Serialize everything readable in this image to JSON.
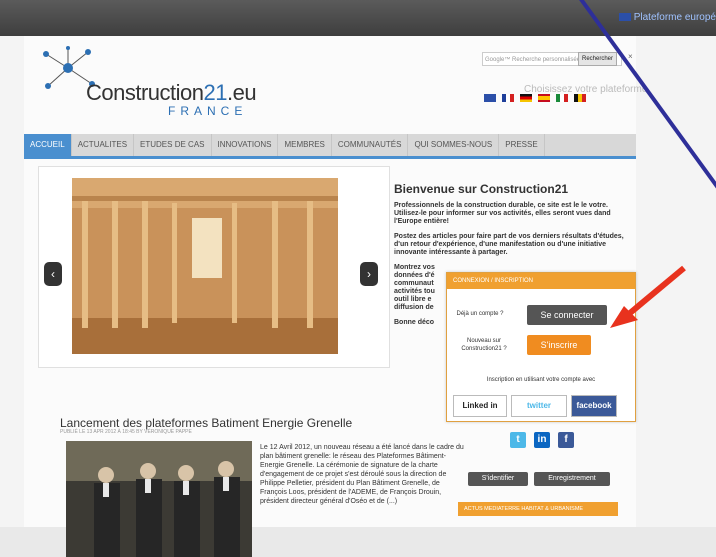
{
  "topbar": {
    "platform_label": "Plateforme europé"
  },
  "logo": {
    "name_prefix": "Construction",
    "name_number": "21",
    "name_suffix": ".eu",
    "country": "FRANCE"
  },
  "search": {
    "placeholder": "Google™ Recherche personnalisée",
    "button_label": "Rechercher",
    "clear": "×"
  },
  "language": {
    "title": "Choisissez votre plateforme"
  },
  "nav": {
    "tabs": [
      "ACCUEIL",
      "ACTUALITES",
      "ETUDES DE CAS",
      "INNOVATIONS",
      "MEMBRES",
      "COMMUNAUTÉS",
      "QUI SOMMES-NOUS",
      "PRESSE"
    ]
  },
  "slider": {
    "prev": "‹",
    "next": "›"
  },
  "welcome": {
    "title": "Bienvenue sur Construction21",
    "p1": "Professionnels de la construction durable, ce site est le le votre. Utilisez-le pour informer sur vos activités, elles seront vues dand l'Europe entière!",
    "p2": "Postez des articles pour faire part de vos derniers résultats d'études, d'un retour d'expérience, d'une manifestation ou d'une initiative innovante intéressante à partager.",
    "p3": "Montrez vos\ndonnées d'é\ncommunaut\nactivités tou\noutil libre e\ndiffusion de",
    "p4": "Bonne déco"
  },
  "login": {
    "header": "CONNEXION / INSCRIPTION",
    "already_label": "Déjà un compte ?",
    "connect_button": "Se connecter",
    "new_label": "Nouveau sur Construction21 ?",
    "register_button": "S'inscrire",
    "social_label": "Inscription en utilisant votre compte avec",
    "linkedin": "Linked in",
    "twitter": "twitter",
    "facebook": "facebook"
  },
  "sidebar": {
    "identify_button": "S'identifier",
    "register_button": "Enregistrement",
    "actus_header": "ACTUS MEDIATERRE HABITAT & URBANISME"
  },
  "article": {
    "title": "Lancement des plateformes Batiment Energie Grenelle",
    "meta": "PUBLIÉ LE 13 APR 2012 À 18:45 BY VÉRONIQUE PAPPE",
    "text": "Le 12 Avril 2012, un nouveau réseau a été lancé dans le cadre du plan bâtiment grenelle: le réseau des Plateformes Bâtiment-Energie Grenelle. La cérémonie de signature de la charte d'engagement de ce projet s'est déroulé sous la direction de Philippe Pelletier, président du Plan Bâtiment Grenelle, de François Loos, président de l'ADEME, de François Drouin, président directeur général d'Oséo et de (...)"
  },
  "colors": {
    "accent": "#4a8fcf",
    "orange": "#f0a030",
    "overlay_line": "#2e2f99",
    "arrow": "#e8321e"
  }
}
